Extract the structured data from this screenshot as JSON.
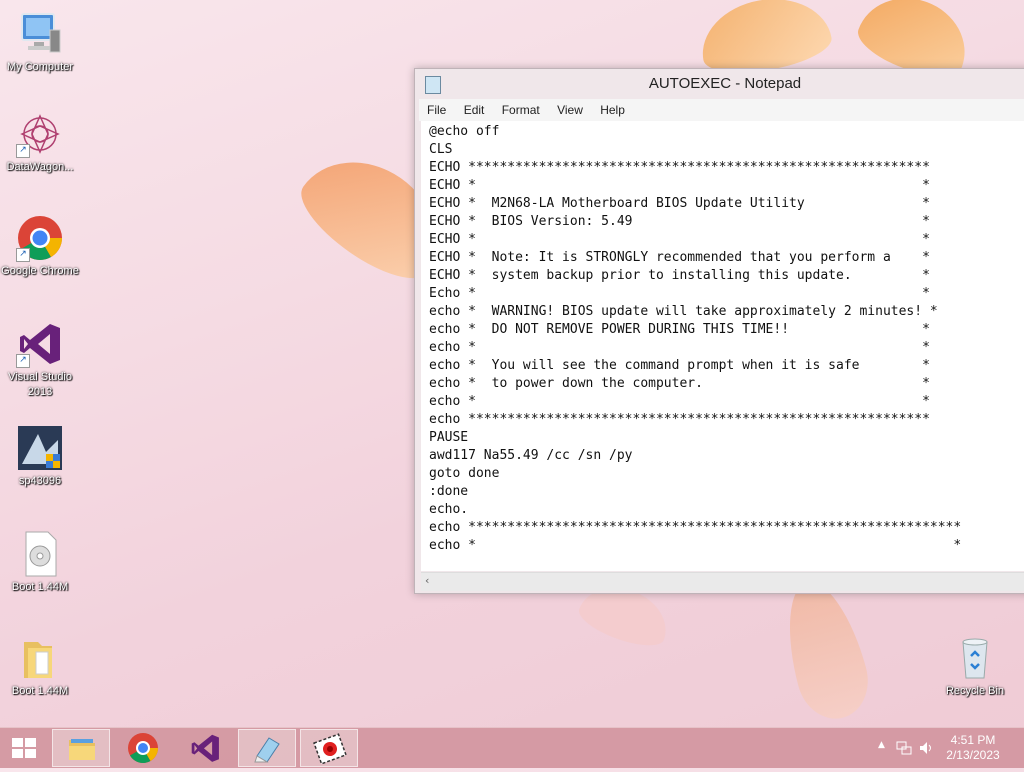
{
  "desktop": {
    "icons": [
      {
        "label": "My Computer",
        "icon": "computer-icon"
      },
      {
        "label": "DataWagon...",
        "icon": "datawagon-icon"
      },
      {
        "label": "Google Chrome",
        "icon": "chrome-icon"
      },
      {
        "label": "Visual Studio 2013",
        "icon": "visual-studio-icon"
      },
      {
        "label": "sp43096",
        "icon": "installer-icon"
      },
      {
        "label": "Boot 1.44M",
        "icon": "disk-image-file-icon"
      },
      {
        "label": "Boot 1.44M",
        "icon": "folder-icon"
      },
      {
        "label": "Recycle Bin",
        "icon": "recycle-bin-icon"
      }
    ]
  },
  "notepad": {
    "title": "AUTOEXEC - Notepad",
    "menu": [
      "File",
      "Edit",
      "Format",
      "View",
      "Help"
    ],
    "content": "@echo off\nCLS\nECHO ***********************************************************\nECHO *                                                         *\nECHO *  M2N68-LA Motherboard BIOS Update Utility               *\nECHO *  BIOS Version: 5.49                                     *\nECHO *                                                         *\nECHO *  Note: It is STRONGLY recommended that you perform a    *\nECHO *  system backup prior to installing this update.         *\nEcho *                                                         *\necho *  WARNING! BIOS update will take approximately 2 minutes! *\necho *  DO NOT REMOVE POWER DURING THIS TIME!!                 *\necho *                                                         *\necho *  You will see the command prompt when it is safe        *\necho *  to power down the computer.                            *\necho *                                                         *\necho ***********************************************************\nPAUSE\nawd117 Na55.49 /cc /sn /py\ngoto done\n:done\necho.\necho ***************************************************************\necho *                                                             *"
  },
  "taskbar": {
    "apps": [
      "file-explorer-icon",
      "chrome-icon",
      "visual-studio-icon",
      "notepad-icon",
      "media-app-icon"
    ],
    "clock": {
      "time": "4:51 PM",
      "date": "2/13/2023"
    }
  },
  "colors": {
    "taskbar": "#d296a0",
    "accent": "#1a73e8"
  }
}
